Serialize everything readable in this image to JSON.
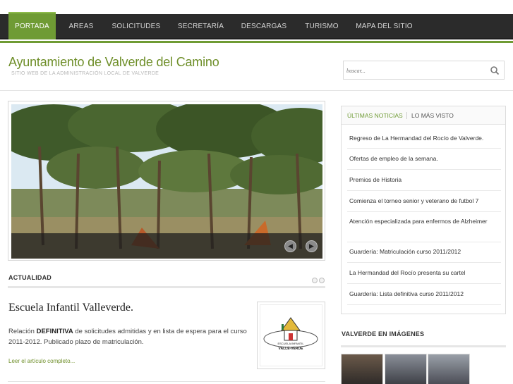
{
  "nav": {
    "items": [
      {
        "label": "PORTADA",
        "active": true
      },
      {
        "label": "AREAS",
        "active": false
      },
      {
        "label": "SOLICITUDES",
        "active": false
      },
      {
        "label": "SECRETARÍA",
        "active": false
      },
      {
        "label": "DESCARGAS",
        "active": false
      },
      {
        "label": "TURISMO",
        "active": false
      },
      {
        "label": "MAPA DEL SITIO",
        "active": false
      }
    ]
  },
  "header": {
    "title": "Ayuntamiento de Valverde del Camino",
    "subtitle": "SITIO WEB DE LA ADMINISTRACIÓN LOCAL DE VALVERDE"
  },
  "search": {
    "placeholder": "buscar...",
    "icon": "search-icon"
  },
  "slider": {
    "prev_icon": "arrow-left-icon",
    "next_icon": "arrow-right-icon"
  },
  "actualidad": {
    "title": "ACTUALIDAD",
    "post": {
      "title": "Escuela Infantil Valleverde.",
      "body_prefix": "Relación ",
      "body_bold": "DEFINITIVA",
      "body_suffix": " de solicitudes admitidas y en lista de espera para el curso 2011-2012. Publicado plazo de matriculación.",
      "more": "Leer el artículo completo...",
      "thumb_line1": "ESCUELA INFANTIL",
      "thumb_line2": "VALLE-VERDE"
    }
  },
  "sidebar": {
    "tabs": [
      {
        "label": "ÚLTIMAS NOTICIAS",
        "active": true
      },
      {
        "label": "LO MÁS VISTO",
        "active": false
      }
    ],
    "news": [
      "Regreso de La Hermandad del Rocío de Valverde.",
      "Ofertas de empleo de la semana.",
      "Premios de Historia",
      "Comienza el torneo senior y veterano de futbol 7",
      "Atención especializada para enfermos de Alzheimer",
      "Guardería: Matriculación curso 2011/2012",
      "La Hermandad del Rocío presenta su cartel",
      "Guardería: Lista definitiva curso 2011/2012"
    ],
    "gallery_title": "VALVERDE EN IMÁGENES"
  },
  "colors": {
    "accent": "#6f9b34",
    "nav_bg": "#2b2b2b",
    "title": "#6f8f2a"
  }
}
